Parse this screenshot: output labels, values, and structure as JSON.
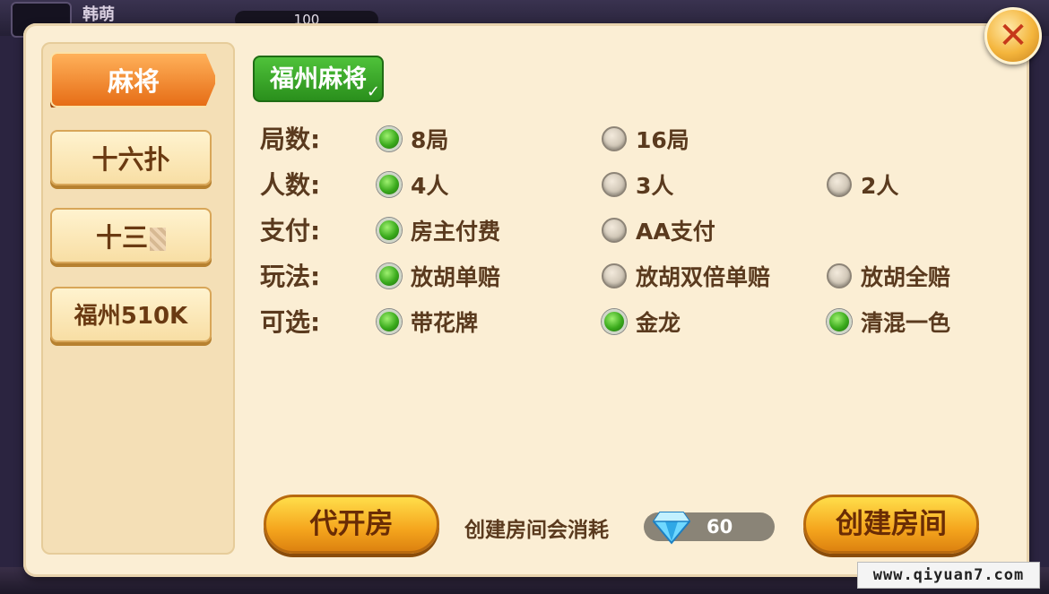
{
  "background": {
    "player_name": "韩萌",
    "coins": "100"
  },
  "watermark": "www.qiyuan7.com",
  "close_icon": "✕",
  "sidebar": {
    "tabs": [
      {
        "label": "麻将",
        "active": true
      },
      {
        "label": "十六扑",
        "active": false
      },
      {
        "label": "十三",
        "active": false
      },
      {
        "label": "福州510K",
        "active": false
      }
    ]
  },
  "game_tag": {
    "label": "福州麻将",
    "check": "✓"
  },
  "rows": [
    {
      "label": "局数:",
      "options": [
        {
          "text": "8局",
          "selected": true
        },
        {
          "text": "16局",
          "selected": false
        }
      ]
    },
    {
      "label": "人数:",
      "options": [
        {
          "text": "4人",
          "selected": true
        },
        {
          "text": "3人",
          "selected": false
        },
        {
          "text": "2人",
          "selected": false
        }
      ]
    },
    {
      "label": "支付:",
      "options": [
        {
          "text": "房主付费",
          "selected": true
        },
        {
          "text": "AA支付",
          "selected": false
        }
      ]
    },
    {
      "label": "玩法:",
      "options": [
        {
          "text": "放胡单赔",
          "selected": true
        },
        {
          "text": "放胡双倍单赔",
          "selected": false
        },
        {
          "text": "放胡全赔",
          "selected": false
        }
      ]
    },
    {
      "label": "可选:",
      "options": [
        {
          "text": "带花牌",
          "selected": true
        },
        {
          "text": "金龙",
          "selected": true
        },
        {
          "text": "清混一色",
          "selected": true
        }
      ]
    }
  ],
  "footer": {
    "proxy_button": "代开房",
    "cost_label": "创建房间会消耗",
    "cost_value": "60",
    "create_button": "创建房间"
  },
  "colors": {
    "selected": "#3aaa1c",
    "accent_orange": "#e66d16",
    "panel": "#fbeed4"
  }
}
